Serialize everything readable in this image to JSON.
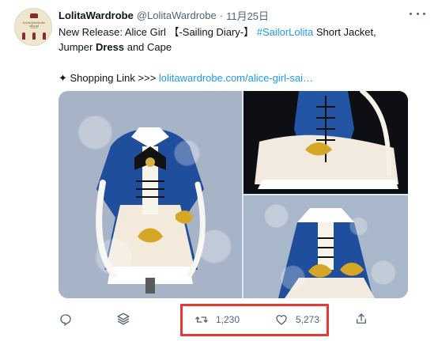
{
  "tweet": {
    "author": {
      "name": "LolitaWardrobe",
      "handle": "@LolitaWardrobe",
      "separator": "·",
      "date": "11月25日",
      "avatar_text": "LolitaWardrobe official",
      "avatar_subtext": "online"
    },
    "text": {
      "line1_a": "New Release: Alice Girl ",
      "line1_b": "【-Sailing Diary-】",
      "line1_hashtag": " #SailorLolita",
      "line1_c": " Short Jacket,",
      "line2_a": "Jumper ",
      "line2_bold": "Dress",
      "line2_b": " and Cape",
      "shopping_prefix": "✦ Shopping Link >>> ",
      "shopping_link": "lolitawardrobe.com/alice-girl-sai…"
    },
    "media": {
      "photos": [
        "lolita-dress-front",
        "lolita-dress-detail-top",
        "lolita-dress-detail-bottom"
      ]
    },
    "actions": {
      "reply_icon": "reply-icon",
      "stack_icon": "stack-icon",
      "retweet_count": "1,230",
      "like_count": "5,273",
      "share_icon": "share-icon"
    },
    "accent": "#1d9bf0",
    "highlight_color": "#e53935"
  }
}
